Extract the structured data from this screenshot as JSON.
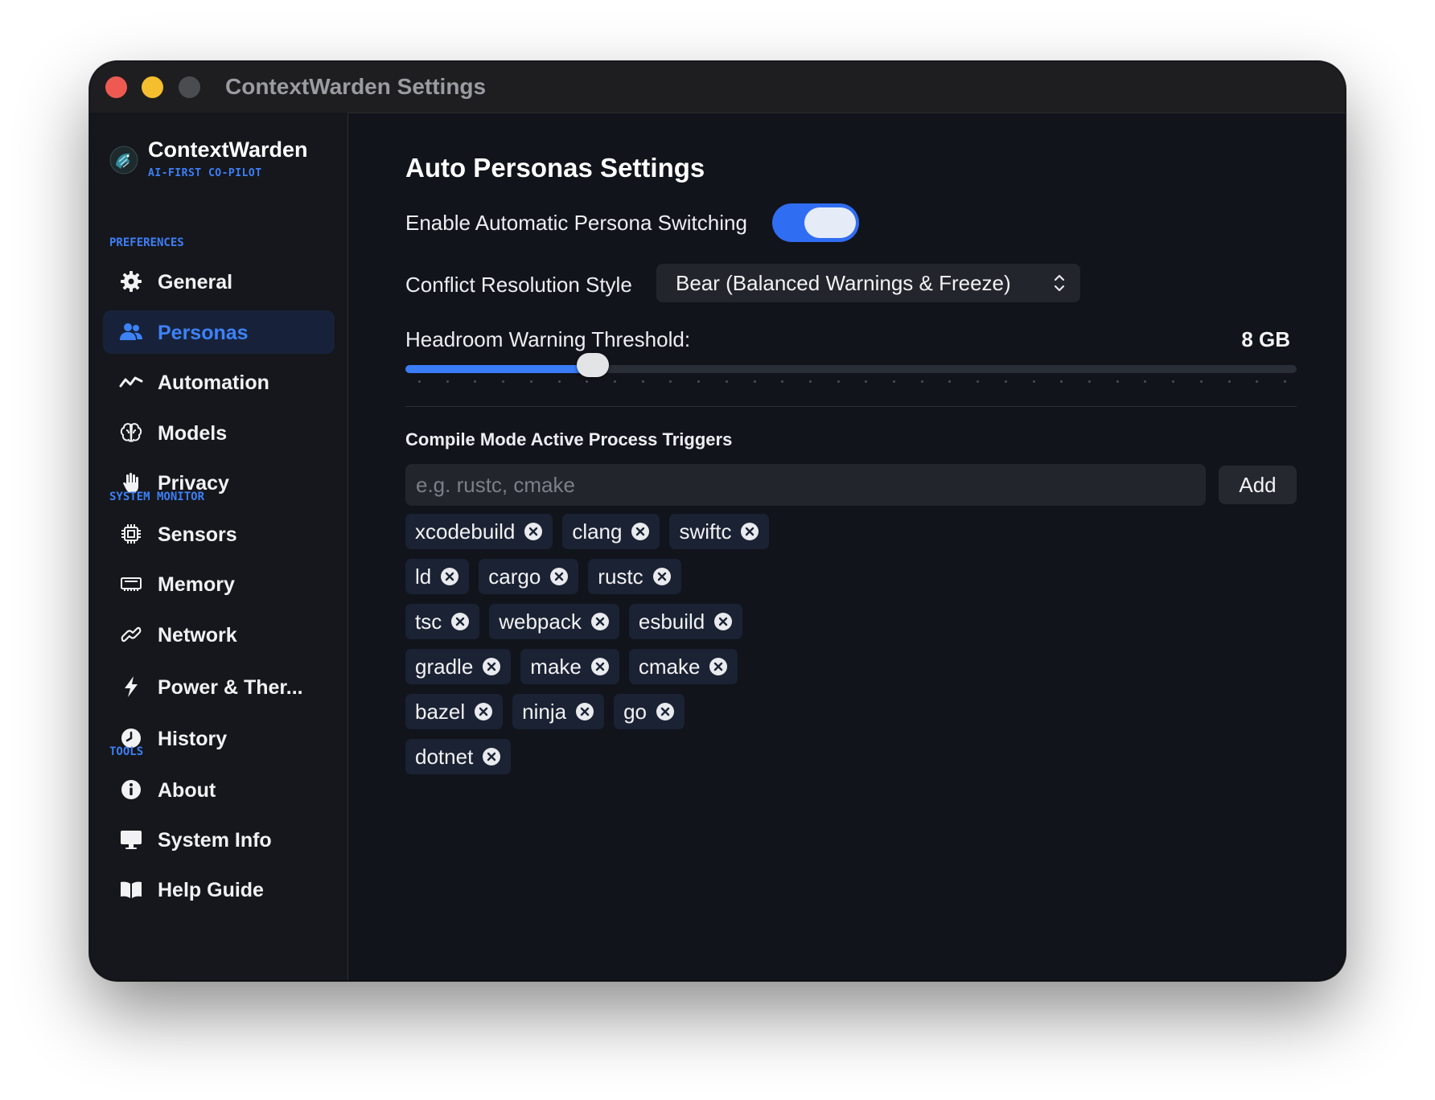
{
  "window": {
    "title": "ContextWarden Settings"
  },
  "sidebar": {
    "brand": {
      "name": "ContextWarden",
      "tagline": "AI-FIRST CO-PILOT"
    },
    "sections": [
      {
        "label": "PREFERENCES",
        "items": [
          {
            "label": "General",
            "icon": "gear-icon"
          },
          {
            "label": "Personas",
            "icon": "people-icon",
            "active": true
          },
          {
            "label": "Automation",
            "icon": "waveform-icon"
          },
          {
            "label": "Models",
            "icon": "brain-icon"
          },
          {
            "label": "Privacy",
            "icon": "hand-icon"
          }
        ]
      },
      {
        "label": "SYSTEM MONITOR",
        "items": [
          {
            "label": "Sensors",
            "icon": "chip-icon"
          },
          {
            "label": "Memory",
            "icon": "memory-icon"
          },
          {
            "label": "Network",
            "icon": "link-icon"
          },
          {
            "label": "Power & Ther...",
            "icon": "bolt-icon"
          },
          {
            "label": "History",
            "icon": "clock-icon"
          }
        ]
      },
      {
        "label": "TOOLS",
        "items": [
          {
            "label": "About",
            "icon": "info-icon"
          },
          {
            "label": "System Info",
            "icon": "monitor-icon"
          },
          {
            "label": "Help Guide",
            "icon": "book-icon"
          }
        ]
      }
    ]
  },
  "main": {
    "title": "Auto Personas Settings",
    "auto_switch": {
      "label": "Enable Automatic Persona Switching",
      "enabled": true
    },
    "conflict": {
      "label": "Conflict Resolution Style",
      "value": "Bear (Balanced Warnings & Freeze)"
    },
    "threshold": {
      "label": "Headroom Warning Threshold:",
      "value_text": "8 GB",
      "fraction": 0.21
    },
    "triggers": {
      "title": "Compile Mode Active Process Triggers",
      "placeholder": "e.g. rustc, cmake",
      "add_label": "Add",
      "rows": [
        [
          "xcodebuild",
          "clang",
          "swiftc"
        ],
        [
          "ld",
          "cargo",
          "rustc"
        ],
        [
          "tsc",
          "webpack",
          "esbuild"
        ],
        [
          "gradle",
          "make",
          "cmake"
        ],
        [
          "bazel",
          "ninja",
          "go"
        ],
        [
          "dotnet"
        ]
      ]
    }
  },
  "colors": {
    "accent": "#3d7ff6",
    "background": "#11141b",
    "sidebar": "#15171c",
    "chip": "#1a2233"
  }
}
